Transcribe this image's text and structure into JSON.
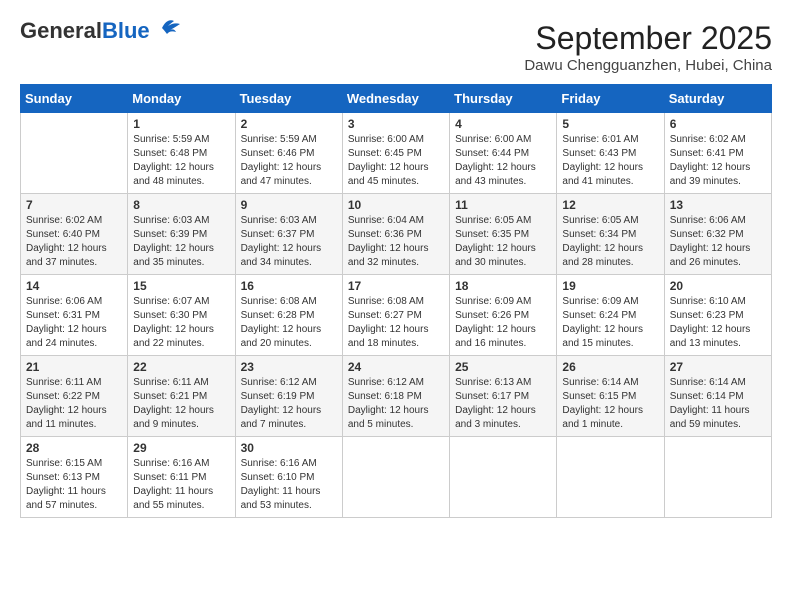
{
  "header": {
    "logo_line1": "General",
    "logo_line2": "Blue",
    "month_year": "September 2025",
    "location": "Dawu Chengguanzhen, Hubei, China"
  },
  "days_of_week": [
    "Sunday",
    "Monday",
    "Tuesday",
    "Wednesday",
    "Thursday",
    "Friday",
    "Saturday"
  ],
  "weeks": [
    [
      {
        "day": "",
        "content": ""
      },
      {
        "day": "1",
        "content": "Sunrise: 5:59 AM\nSunset: 6:48 PM\nDaylight: 12 hours\nand 48 minutes."
      },
      {
        "day": "2",
        "content": "Sunrise: 5:59 AM\nSunset: 6:46 PM\nDaylight: 12 hours\nand 47 minutes."
      },
      {
        "day": "3",
        "content": "Sunrise: 6:00 AM\nSunset: 6:45 PM\nDaylight: 12 hours\nand 45 minutes."
      },
      {
        "day": "4",
        "content": "Sunrise: 6:00 AM\nSunset: 6:44 PM\nDaylight: 12 hours\nand 43 minutes."
      },
      {
        "day": "5",
        "content": "Sunrise: 6:01 AM\nSunset: 6:43 PM\nDaylight: 12 hours\nand 41 minutes."
      },
      {
        "day": "6",
        "content": "Sunrise: 6:02 AM\nSunset: 6:41 PM\nDaylight: 12 hours\nand 39 minutes."
      }
    ],
    [
      {
        "day": "7",
        "content": "Sunrise: 6:02 AM\nSunset: 6:40 PM\nDaylight: 12 hours\nand 37 minutes."
      },
      {
        "day": "8",
        "content": "Sunrise: 6:03 AM\nSunset: 6:39 PM\nDaylight: 12 hours\nand 35 minutes."
      },
      {
        "day": "9",
        "content": "Sunrise: 6:03 AM\nSunset: 6:37 PM\nDaylight: 12 hours\nand 34 minutes."
      },
      {
        "day": "10",
        "content": "Sunrise: 6:04 AM\nSunset: 6:36 PM\nDaylight: 12 hours\nand 32 minutes."
      },
      {
        "day": "11",
        "content": "Sunrise: 6:05 AM\nSunset: 6:35 PM\nDaylight: 12 hours\nand 30 minutes."
      },
      {
        "day": "12",
        "content": "Sunrise: 6:05 AM\nSunset: 6:34 PM\nDaylight: 12 hours\nand 28 minutes."
      },
      {
        "day": "13",
        "content": "Sunrise: 6:06 AM\nSunset: 6:32 PM\nDaylight: 12 hours\nand 26 minutes."
      }
    ],
    [
      {
        "day": "14",
        "content": "Sunrise: 6:06 AM\nSunset: 6:31 PM\nDaylight: 12 hours\nand 24 minutes."
      },
      {
        "day": "15",
        "content": "Sunrise: 6:07 AM\nSunset: 6:30 PM\nDaylight: 12 hours\nand 22 minutes."
      },
      {
        "day": "16",
        "content": "Sunrise: 6:08 AM\nSunset: 6:28 PM\nDaylight: 12 hours\nand 20 minutes."
      },
      {
        "day": "17",
        "content": "Sunrise: 6:08 AM\nSunset: 6:27 PM\nDaylight: 12 hours\nand 18 minutes."
      },
      {
        "day": "18",
        "content": "Sunrise: 6:09 AM\nSunset: 6:26 PM\nDaylight: 12 hours\nand 16 minutes."
      },
      {
        "day": "19",
        "content": "Sunrise: 6:09 AM\nSunset: 6:24 PM\nDaylight: 12 hours\nand 15 minutes."
      },
      {
        "day": "20",
        "content": "Sunrise: 6:10 AM\nSunset: 6:23 PM\nDaylight: 12 hours\nand 13 minutes."
      }
    ],
    [
      {
        "day": "21",
        "content": "Sunrise: 6:11 AM\nSunset: 6:22 PM\nDaylight: 12 hours\nand 11 minutes."
      },
      {
        "day": "22",
        "content": "Sunrise: 6:11 AM\nSunset: 6:21 PM\nDaylight: 12 hours\nand 9 minutes."
      },
      {
        "day": "23",
        "content": "Sunrise: 6:12 AM\nSunset: 6:19 PM\nDaylight: 12 hours\nand 7 minutes."
      },
      {
        "day": "24",
        "content": "Sunrise: 6:12 AM\nSunset: 6:18 PM\nDaylight: 12 hours\nand 5 minutes."
      },
      {
        "day": "25",
        "content": "Sunrise: 6:13 AM\nSunset: 6:17 PM\nDaylight: 12 hours\nand 3 minutes."
      },
      {
        "day": "26",
        "content": "Sunrise: 6:14 AM\nSunset: 6:15 PM\nDaylight: 12 hours\nand 1 minute."
      },
      {
        "day": "27",
        "content": "Sunrise: 6:14 AM\nSunset: 6:14 PM\nDaylight: 11 hours\nand 59 minutes."
      }
    ],
    [
      {
        "day": "28",
        "content": "Sunrise: 6:15 AM\nSunset: 6:13 PM\nDaylight: 11 hours\nand 57 minutes."
      },
      {
        "day": "29",
        "content": "Sunrise: 6:16 AM\nSunset: 6:11 PM\nDaylight: 11 hours\nand 55 minutes."
      },
      {
        "day": "30",
        "content": "Sunrise: 6:16 AM\nSunset: 6:10 PM\nDaylight: 11 hours\nand 53 minutes."
      },
      {
        "day": "",
        "content": ""
      },
      {
        "day": "",
        "content": ""
      },
      {
        "day": "",
        "content": ""
      },
      {
        "day": "",
        "content": ""
      }
    ]
  ]
}
